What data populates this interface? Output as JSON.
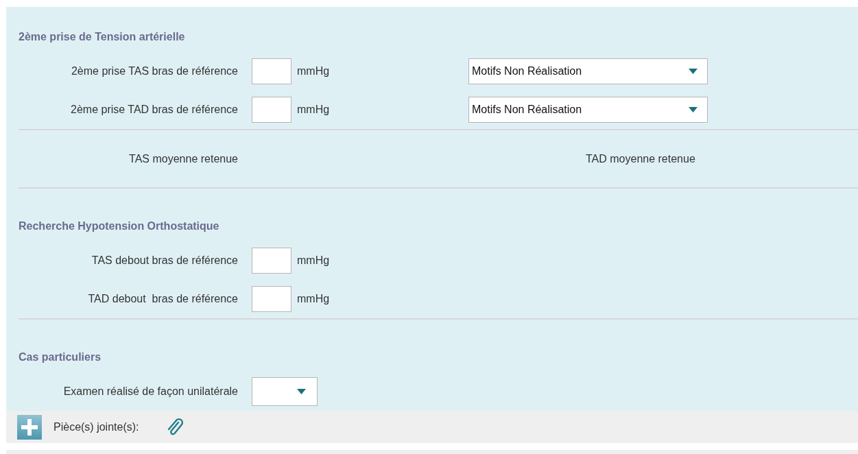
{
  "sections": [
    {
      "kind": "fields",
      "title": "2ème prise de Tension artérielle",
      "rows": [
        {
          "kind": "number",
          "label": "2ème prise TAS bras de référence",
          "unit": "mmHg",
          "dropdown": "Motifs Non Réalisation"
        },
        {
          "kind": "number",
          "label": "2ème prise TAD bras de référence",
          "unit": "mmHg",
          "dropdown": "Motifs Non Réalisation"
        }
      ]
    },
    {
      "kind": "averages",
      "items": [
        "TAS moyenne retenue",
        "TAD moyenne retenue"
      ]
    },
    {
      "kind": "fields",
      "title": "Recherche Hypotension Orthostatique",
      "rows": [
        {
          "kind": "number",
          "label": "TAS debout bras de référence",
          "unit": "mmHg"
        },
        {
          "kind": "number",
          "label": "TAD debout  bras de référence",
          "unit": "mmHg"
        }
      ]
    },
    {
      "kind": "fields",
      "title": "Cas particuliers",
      "rows": [
        {
          "kind": "select",
          "label": "Examen réalisé de façon unilatérale"
        }
      ]
    }
  ],
  "footer": {
    "label": "Pièce(s) jointe(s):"
  }
}
